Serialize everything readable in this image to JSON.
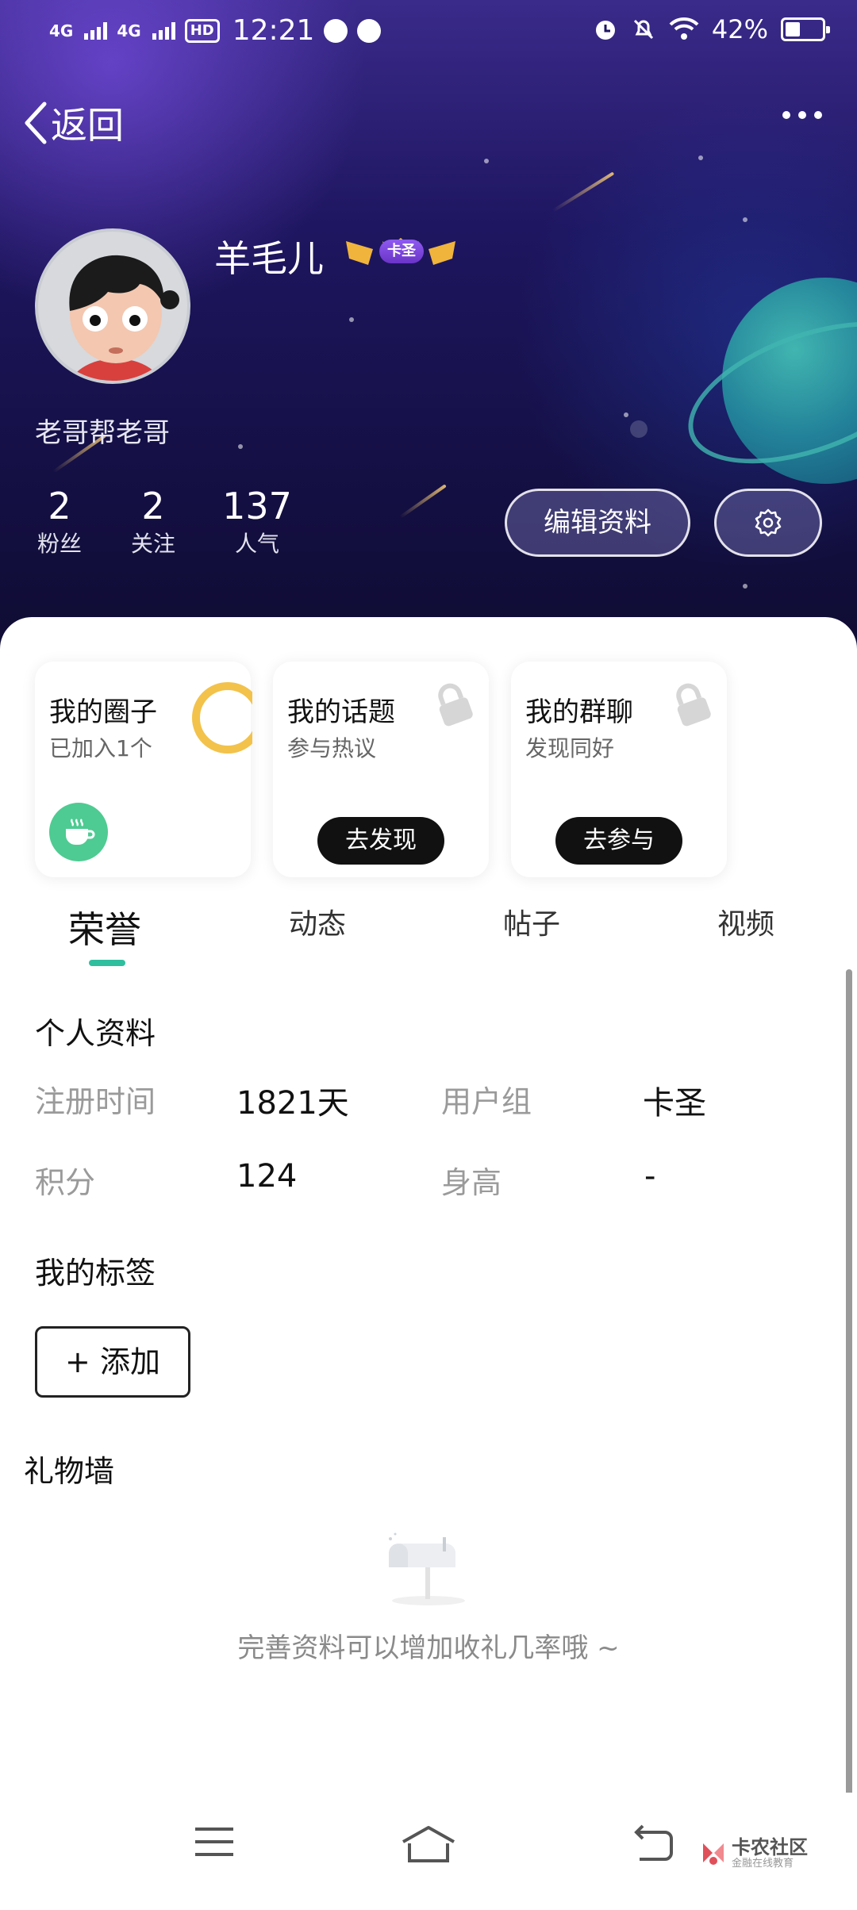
{
  "status_bar": {
    "signal_1": "4G",
    "signal_2": "4G",
    "hd": "HD",
    "time": "12:21",
    "battery": "42%",
    "battery_level": 0.42
  },
  "nav": {
    "back_label": "返回"
  },
  "profile": {
    "name": "羊毛儿",
    "badge": "卡圣",
    "signature": "老哥帮老哥",
    "stats": [
      {
        "value": "2",
        "label": "粉丝"
      },
      {
        "value": "2",
        "label": "关注"
      },
      {
        "value": "137",
        "label": "人气"
      }
    ],
    "edit_label": "编辑资料"
  },
  "cards": [
    {
      "title": "我的圈子",
      "subtitle": "已加入1个"
    },
    {
      "title": "我的话题",
      "subtitle": "参与热议",
      "button": "去发现"
    },
    {
      "title": "我的群聊",
      "subtitle": "发现同好",
      "button": "去参与"
    }
  ],
  "tabs": [
    "荣誉",
    "动态",
    "帖子",
    "视频"
  ],
  "personal_info": {
    "title": "个人资料",
    "fields": [
      {
        "label": "注册时间",
        "value": "1821天"
      },
      {
        "label": "用户组",
        "value": "卡圣"
      },
      {
        "label": "积分",
        "value": "124"
      },
      {
        "label": "身高",
        "value": "-"
      }
    ]
  },
  "tags": {
    "title": "我的标签",
    "add_label": "+ 添加"
  },
  "gift_wall": {
    "title": "礼物墙",
    "empty_tip": "完善资料可以增加收礼几率哦 ~"
  },
  "watermark": {
    "line1": "卡农社区",
    "line2": "金融在线教育"
  },
  "colors": {
    "accent": "#2fbf9f",
    "header_bg": "#1e1660",
    "badge": "#7b45dc",
    "cup": "#4ecb92"
  }
}
